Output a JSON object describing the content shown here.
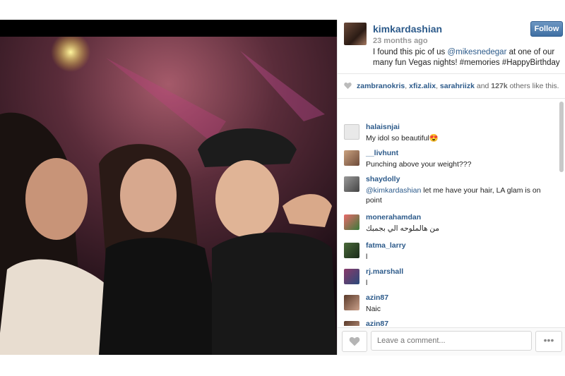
{
  "post": {
    "username": "kimkardashian",
    "time_ago": "23 months ago",
    "follow_label": "Follow",
    "caption_pre": "I found this pic of us ",
    "caption_mention": "@mikesnedegar",
    "caption_post": " at one of our many fun Vegas nights! #memories #HappyBirthday"
  },
  "likes": {
    "user1": "zambranokris",
    "sep1": ", ",
    "user2": "xfiz.alix",
    "sep2": ", ",
    "user3": "sarahriizk",
    "mid": " and ",
    "count": "127k",
    "tail": " others like this."
  },
  "comments": [
    {
      "user": "halaisnjai",
      "text": "My idol so beautiful😍"
    },
    {
      "user": "__livhunt",
      "text": "Punching above your weight???"
    },
    {
      "user": "shaydolly",
      "mention": "@kimkardashian",
      "text": " let me have your hair, LA glam is on point"
    },
    {
      "user": "monerahamdan",
      "text": "من هالملوحه الي بجمبك"
    },
    {
      "user": "fatma_larry",
      "text": "l"
    },
    {
      "user": "rj.marshall",
      "text": "l"
    },
    {
      "user": "azin87",
      "text": "Naic"
    },
    {
      "user": "azin87",
      "text": ""
    }
  ],
  "footer": {
    "comment_placeholder": "Leave a comment...",
    "more_label": "•••"
  },
  "colors": {
    "link": "#2c5a8a",
    "follow_bg": "#4b7bb0"
  }
}
